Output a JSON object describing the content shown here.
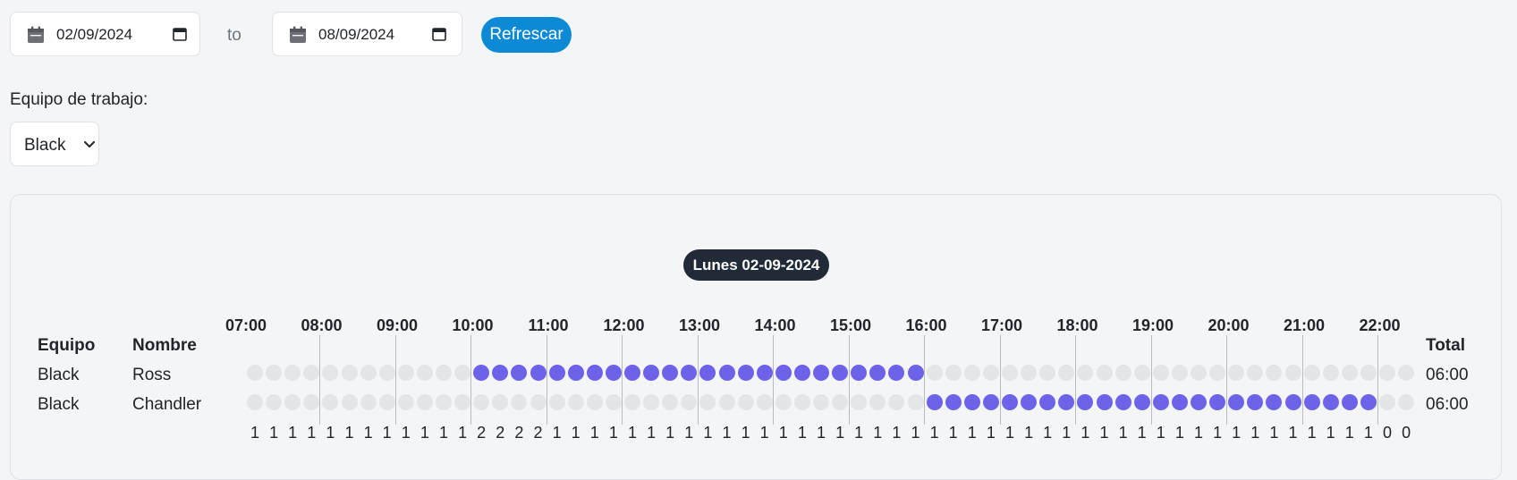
{
  "date_range": {
    "from": "02/09/2024",
    "separator": "to",
    "to": "08/09/2024",
    "refresh_label": "Refrescar"
  },
  "team_filter": {
    "label": "Equipo de trabajo:",
    "selected": "Black"
  },
  "schedule": {
    "day_label": "Lunes 02-09-2024",
    "headers": {
      "team": "Equipo",
      "name": "Nombre",
      "total": "Total"
    },
    "hours": [
      "07:00",
      "08:00",
      "09:00",
      "10:00",
      "11:00",
      "12:00",
      "13:00",
      "14:00",
      "15:00",
      "16:00",
      "17:00",
      "18:00",
      "19:00",
      "20:00",
      "21:00",
      "22:00"
    ],
    "rows": [
      {
        "team": "Black",
        "name": "Ross",
        "total": "06:00",
        "active_from": 12,
        "active_to": 35
      },
      {
        "team": "Black",
        "name": "Chandler",
        "total": "06:00",
        "active_from": 36,
        "active_to": 59
      }
    ],
    "slot_count": 62,
    "counts": [
      1,
      1,
      1,
      1,
      1,
      1,
      1,
      1,
      1,
      1,
      1,
      1,
      2,
      2,
      2,
      2,
      1,
      1,
      1,
      1,
      1,
      1,
      1,
      1,
      1,
      1,
      1,
      1,
      1,
      1,
      1,
      1,
      1,
      1,
      1,
      1,
      1,
      1,
      1,
      1,
      1,
      1,
      1,
      1,
      1,
      1,
      1,
      1,
      1,
      1,
      1,
      1,
      1,
      1,
      1,
      1,
      1,
      1,
      1,
      1,
      0,
      0
    ],
    "colors": {
      "active": "#6c63e8",
      "inactive": "#e4e5e7"
    }
  }
}
